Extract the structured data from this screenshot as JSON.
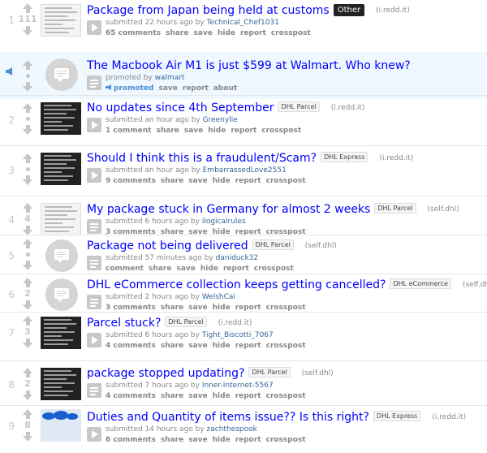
{
  "posts": [
    {
      "rank": "1",
      "score": "111",
      "title": "Package from Japan being held at customs",
      "flair": "Other",
      "flair_style": "dark",
      "domain": "(i.redd.it)",
      "thumb": "light-doc",
      "expando": "play",
      "submitted": "submitted 22 hours ago by",
      "author": "Technical_Chef1031",
      "actions": [
        "65 comments",
        "share",
        "save",
        "hide",
        "report",
        "crosspost"
      ]
    },
    {
      "rank": "",
      "score": "",
      "promoted": true,
      "title": "The Macbook Air M1 is just $599 at Walmart. Who knew?",
      "flair": "",
      "domain": "",
      "thumb": "self",
      "expando": "text",
      "submitted": "promoted by",
      "author": "walmart",
      "actions": [
        "promoted",
        "save",
        "report",
        "about"
      ]
    },
    {
      "rank": "2",
      "score": "",
      "title": "No updates since 4th September",
      "flair": "DHL Parcel",
      "domain": "(i.redd.it)",
      "thumb": "dark-doc",
      "expando": "play",
      "submitted": "submitted an hour ago by",
      "author": "Greenylie",
      "actions": [
        "1 comment",
        "share",
        "save",
        "hide",
        "report",
        "crosspost"
      ]
    },
    {
      "rank": "3",
      "score": "",
      "title": "Should I think this is a fraudulent/Scam?",
      "flair": "DHL Express",
      "domain": "(i.redd.it)",
      "thumb": "dark-doc",
      "expando": "play",
      "submitted": "submitted an hour ago by",
      "author": "EmbarrassedLove2551",
      "actions": [
        "9 comments",
        "share",
        "save",
        "hide",
        "report",
        "crosspost"
      ]
    },
    {
      "rank": "4",
      "score": "4",
      "title": "My package stuck in Germany for almost 2 weeks",
      "flair": "DHL Parcel",
      "domain": "(self.dhl)",
      "thumb": "light-doc",
      "expando": "text",
      "submitted": "submitted 6 hours ago by",
      "author": "ilogicalrules",
      "actions": [
        "3 comments",
        "share",
        "save",
        "hide",
        "report",
        "crosspost"
      ]
    },
    {
      "rank": "5",
      "score": "",
      "title": "Package not being delivered",
      "flair": "DHL Parcel",
      "domain": "(self.dhl)",
      "thumb": "self",
      "expando": "text",
      "submitted": "submitted 57 minutes ago by",
      "author": "daniduck32",
      "actions": [
        "comment",
        "share",
        "save",
        "hide",
        "report",
        "crosspost"
      ]
    },
    {
      "rank": "6",
      "score": "2",
      "title": "DHL eCommerce collection keeps getting cancelled?",
      "flair": "DHL eCommerce",
      "domain": "(self.dhl)",
      "thumb": "self",
      "expando": "text",
      "submitted": "submitted 2 hours ago by",
      "author": "WelshCai",
      "actions": [
        "3 comments",
        "share",
        "save",
        "hide",
        "report",
        "crosspost"
      ]
    },
    {
      "rank": "7",
      "score": "3",
      "title": "Parcel stuck?",
      "flair": "DHL Parcel",
      "domain": "(i.redd.it)",
      "thumb": "dark-doc",
      "expando": "play",
      "submitted": "submitted 6 hours ago by",
      "author": "Tight_Biscotti_7067",
      "actions": [
        "4 comments",
        "share",
        "save",
        "hide",
        "report",
        "crosspost"
      ]
    },
    {
      "rank": "8",
      "score": "2",
      "title": "package stopped updating?",
      "flair": "DHL Parcel",
      "domain": "(self.dhl)",
      "thumb": "dark-doc",
      "expando": "text",
      "submitted": "submitted 7 hours ago by",
      "author": "Inner-Internet-5567",
      "actions": [
        "4 comments",
        "share",
        "save",
        "hide",
        "report",
        "crosspost"
      ]
    },
    {
      "rank": "9",
      "score": "8",
      "title": "Duties and Quantity of items issue?? Is this right?",
      "flair": "DHL Express",
      "domain": "(i.redd.it)",
      "thumb": "blue-photo",
      "expando": "play",
      "submitted": "submitted 14 hours ago by",
      "author": "zachthespook",
      "actions": [
        "6 comments",
        "share",
        "save",
        "hide",
        "report",
        "crosspost"
      ]
    }
  ],
  "colors": {
    "title": "#0000ff",
    "author": "#336699",
    "promo_bg": "#eff7ff",
    "flair_dark": "#222222"
  },
  "icons": {
    "upvote": "upvote-arrow-icon",
    "downvote": "downvote-arrow-icon",
    "play": "play-icon",
    "self": "text-post-icon",
    "promoted": "megaphone-icon"
  }
}
